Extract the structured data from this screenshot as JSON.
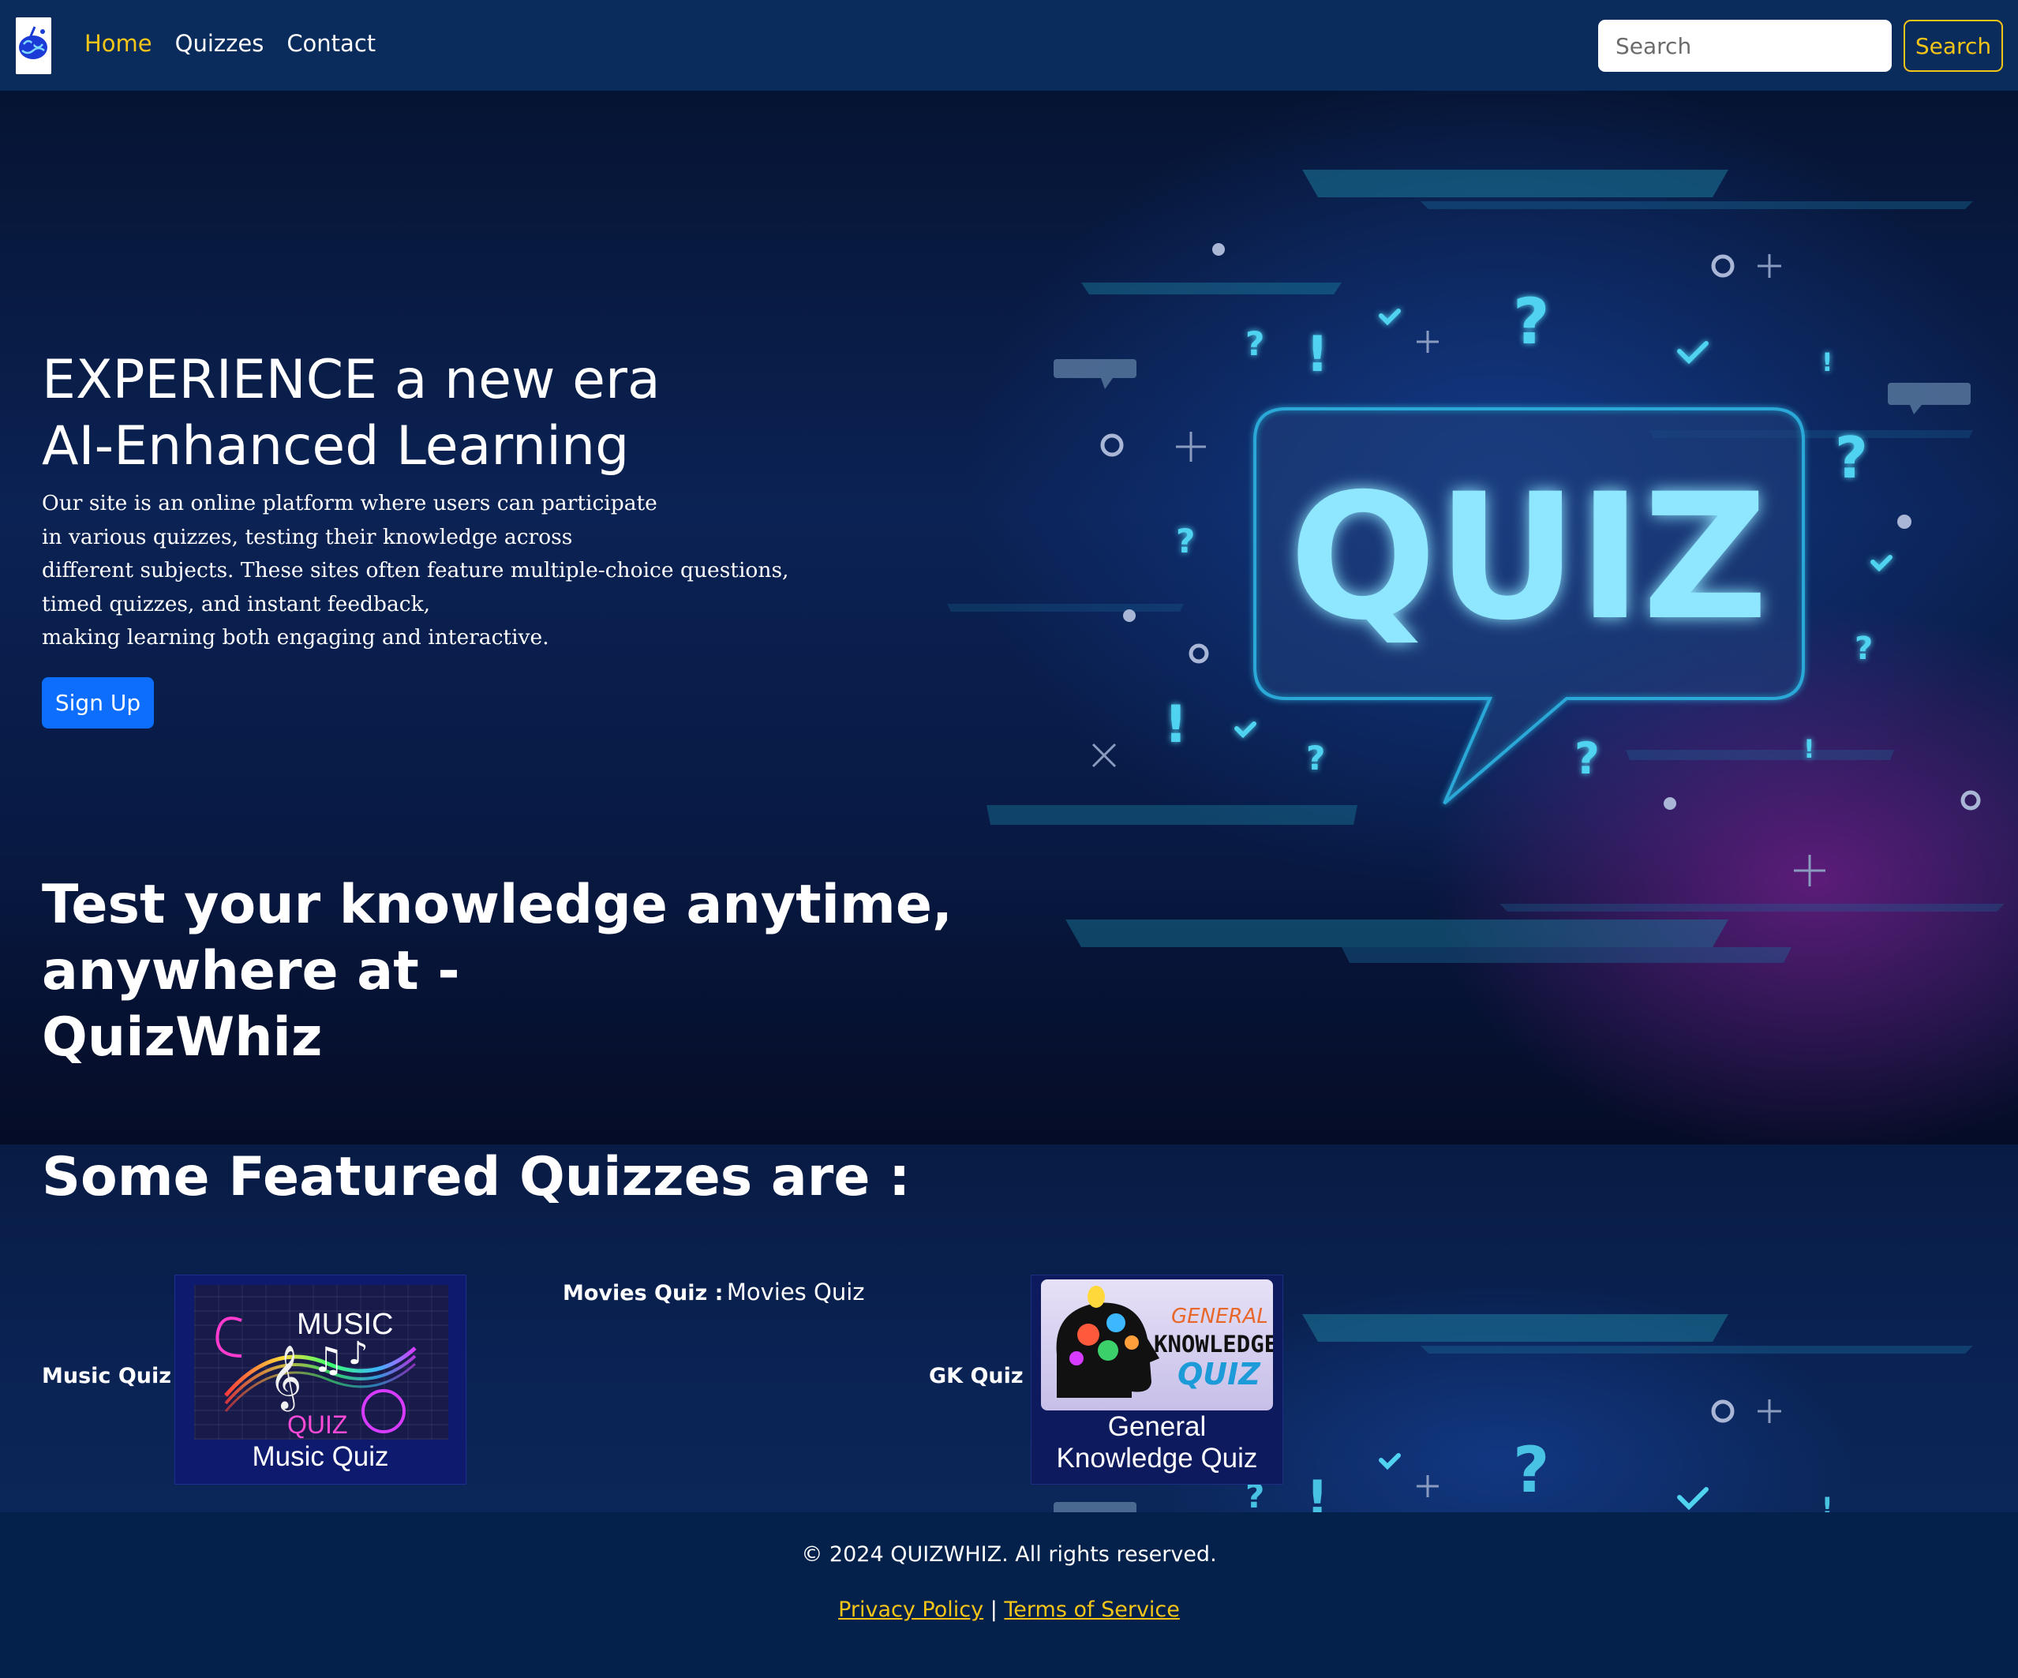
{
  "nav": {
    "links": [
      {
        "label": "Home",
        "active": true
      },
      {
        "label": "Quizzes",
        "active": false
      },
      {
        "label": "Contact",
        "active": false
      }
    ],
    "search_placeholder": "Search",
    "search_button": "Search"
  },
  "hero": {
    "title_line1": "EXPERIENCE a new era",
    "title_line2": "AI-Enhanced Learning",
    "description_lines": [
      "Our site is an online platform where users can participate",
      "in various quizzes, testing their knowledge across",
      "different subjects. These sites often feature multiple-choice questions,",
      "timed quizzes, and instant feedback,",
      "making learning both engaging and interactive."
    ],
    "signup_button": "Sign Up",
    "tagline": "Test your knowledge anytime, anywhere at -",
    "brand": "QuizWhiz",
    "art_text": "QUIZ"
  },
  "featured": {
    "title": "Some Featured Quizzes are :",
    "quizzes": [
      {
        "label": "Music Quiz :",
        "caption": "Music Quiz",
        "art_line1": "MUSIC",
        "art_line2": "QUIZ"
      },
      {
        "label": "Movies Quiz :",
        "alt_text": "Movies Quiz"
      },
      {
        "label": "GK Quiz :",
        "caption_line1": "General",
        "caption_line2": "Knowledge Quiz",
        "art_line1": "GENERAL",
        "art_line2": "KNOWLEDGE",
        "art_line3": "QUIZ"
      }
    ]
  },
  "footer": {
    "copyright": "© 2024 QUIZWHIZ. All rights reserved.",
    "privacy": "Privacy Policy",
    "separator": "|",
    "terms": "Terms of Service"
  },
  "colors": {
    "accent": "#f5c518",
    "primary_button": "#0d6efd",
    "navbar": "#0a2c5c",
    "footer": "#03214a",
    "neon": "#8fe6ff"
  }
}
